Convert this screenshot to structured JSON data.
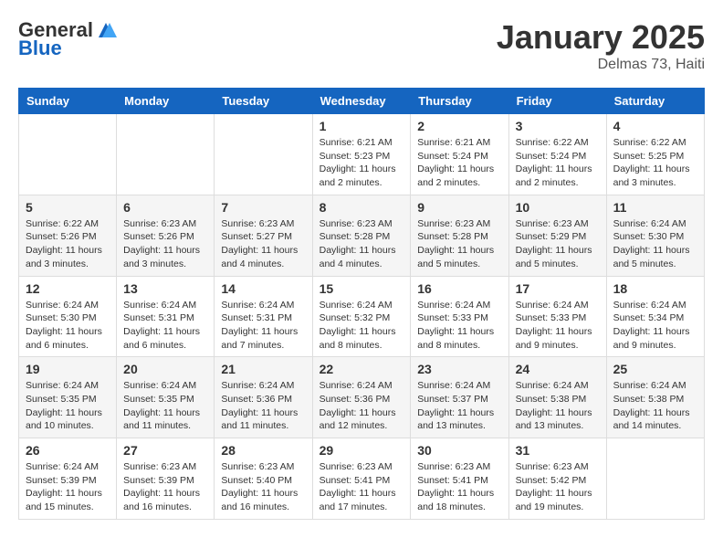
{
  "header": {
    "logo_general": "General",
    "logo_blue": "Blue",
    "month": "January 2025",
    "location": "Delmas 73, Haiti"
  },
  "days_of_week": [
    "Sunday",
    "Monday",
    "Tuesday",
    "Wednesday",
    "Thursday",
    "Friday",
    "Saturday"
  ],
  "weeks": [
    [
      {
        "day": "",
        "info": ""
      },
      {
        "day": "",
        "info": ""
      },
      {
        "day": "",
        "info": ""
      },
      {
        "day": "1",
        "info": "Sunrise: 6:21 AM\nSunset: 5:23 PM\nDaylight: 11 hours and 2 minutes."
      },
      {
        "day": "2",
        "info": "Sunrise: 6:21 AM\nSunset: 5:24 PM\nDaylight: 11 hours and 2 minutes."
      },
      {
        "day": "3",
        "info": "Sunrise: 6:22 AM\nSunset: 5:24 PM\nDaylight: 11 hours and 2 minutes."
      },
      {
        "day": "4",
        "info": "Sunrise: 6:22 AM\nSunset: 5:25 PM\nDaylight: 11 hours and 3 minutes."
      }
    ],
    [
      {
        "day": "5",
        "info": "Sunrise: 6:22 AM\nSunset: 5:26 PM\nDaylight: 11 hours and 3 minutes."
      },
      {
        "day": "6",
        "info": "Sunrise: 6:23 AM\nSunset: 5:26 PM\nDaylight: 11 hours and 3 minutes."
      },
      {
        "day": "7",
        "info": "Sunrise: 6:23 AM\nSunset: 5:27 PM\nDaylight: 11 hours and 4 minutes."
      },
      {
        "day": "8",
        "info": "Sunrise: 6:23 AM\nSunset: 5:28 PM\nDaylight: 11 hours and 4 minutes."
      },
      {
        "day": "9",
        "info": "Sunrise: 6:23 AM\nSunset: 5:28 PM\nDaylight: 11 hours and 5 minutes."
      },
      {
        "day": "10",
        "info": "Sunrise: 6:23 AM\nSunset: 5:29 PM\nDaylight: 11 hours and 5 minutes."
      },
      {
        "day": "11",
        "info": "Sunrise: 6:24 AM\nSunset: 5:30 PM\nDaylight: 11 hours and 5 minutes."
      }
    ],
    [
      {
        "day": "12",
        "info": "Sunrise: 6:24 AM\nSunset: 5:30 PM\nDaylight: 11 hours and 6 minutes."
      },
      {
        "day": "13",
        "info": "Sunrise: 6:24 AM\nSunset: 5:31 PM\nDaylight: 11 hours and 6 minutes."
      },
      {
        "day": "14",
        "info": "Sunrise: 6:24 AM\nSunset: 5:31 PM\nDaylight: 11 hours and 7 minutes."
      },
      {
        "day": "15",
        "info": "Sunrise: 6:24 AM\nSunset: 5:32 PM\nDaylight: 11 hours and 8 minutes."
      },
      {
        "day": "16",
        "info": "Sunrise: 6:24 AM\nSunset: 5:33 PM\nDaylight: 11 hours and 8 minutes."
      },
      {
        "day": "17",
        "info": "Sunrise: 6:24 AM\nSunset: 5:33 PM\nDaylight: 11 hours and 9 minutes."
      },
      {
        "day": "18",
        "info": "Sunrise: 6:24 AM\nSunset: 5:34 PM\nDaylight: 11 hours and 9 minutes."
      }
    ],
    [
      {
        "day": "19",
        "info": "Sunrise: 6:24 AM\nSunset: 5:35 PM\nDaylight: 11 hours and 10 minutes."
      },
      {
        "day": "20",
        "info": "Sunrise: 6:24 AM\nSunset: 5:35 PM\nDaylight: 11 hours and 11 minutes."
      },
      {
        "day": "21",
        "info": "Sunrise: 6:24 AM\nSunset: 5:36 PM\nDaylight: 11 hours and 11 minutes."
      },
      {
        "day": "22",
        "info": "Sunrise: 6:24 AM\nSunset: 5:36 PM\nDaylight: 11 hours and 12 minutes."
      },
      {
        "day": "23",
        "info": "Sunrise: 6:24 AM\nSunset: 5:37 PM\nDaylight: 11 hours and 13 minutes."
      },
      {
        "day": "24",
        "info": "Sunrise: 6:24 AM\nSunset: 5:38 PM\nDaylight: 11 hours and 13 minutes."
      },
      {
        "day": "25",
        "info": "Sunrise: 6:24 AM\nSunset: 5:38 PM\nDaylight: 11 hours and 14 minutes."
      }
    ],
    [
      {
        "day": "26",
        "info": "Sunrise: 6:24 AM\nSunset: 5:39 PM\nDaylight: 11 hours and 15 minutes."
      },
      {
        "day": "27",
        "info": "Sunrise: 6:23 AM\nSunset: 5:39 PM\nDaylight: 11 hours and 16 minutes."
      },
      {
        "day": "28",
        "info": "Sunrise: 6:23 AM\nSunset: 5:40 PM\nDaylight: 11 hours and 16 minutes."
      },
      {
        "day": "29",
        "info": "Sunrise: 6:23 AM\nSunset: 5:41 PM\nDaylight: 11 hours and 17 minutes."
      },
      {
        "day": "30",
        "info": "Sunrise: 6:23 AM\nSunset: 5:41 PM\nDaylight: 11 hours and 18 minutes."
      },
      {
        "day": "31",
        "info": "Sunrise: 6:23 AM\nSunset: 5:42 PM\nDaylight: 11 hours and 19 minutes."
      },
      {
        "day": "",
        "info": ""
      }
    ]
  ]
}
